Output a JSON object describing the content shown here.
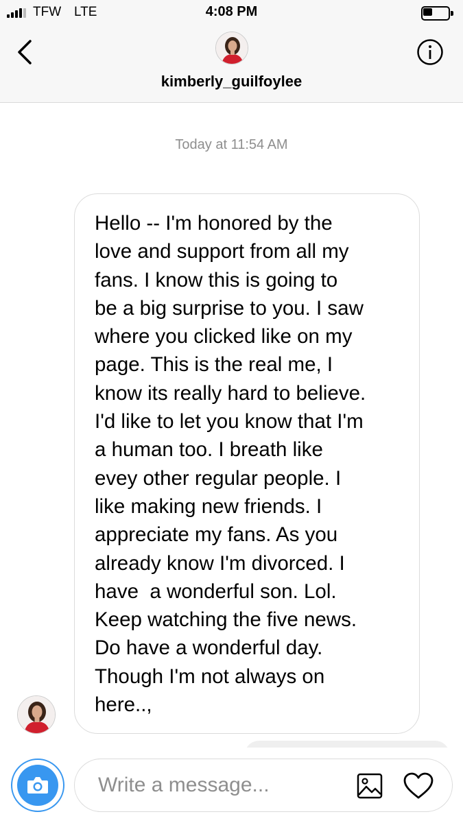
{
  "status_bar": {
    "carrier": "TFW",
    "network": "LTE",
    "time": "4:08 PM",
    "signal_bars": 4,
    "battery_level": 0.3
  },
  "header": {
    "back_icon": "chevron-left-icon",
    "username": "kimberly_guilfoylee",
    "info_icon": "info-icon"
  },
  "conversation": {
    "timestamp": "Today at 11:54 AM",
    "message": "Hello -- I'm honored by the\nlove and support from all my\nfans. I know this is going to\nbe a big surprise to you. I saw\nwhere you clicked like on my\npage. This is the real me, I\nknow its really hard to believe.\nI'd like to let you know that I'm\na human too. I breath like\nevey other regular people. I\nlike making new friends. I\nappreciate my fans. As you\nalready know I'm divorced. I\nhave  a wonderful son. Lol.\nKeep watching the five news.\nDo have a wonderful day.\nThough I'm not always on\nhere..,"
  },
  "composer": {
    "placeholder": "Write a message...",
    "camera_icon": "camera-icon",
    "gallery_icon": "image-icon",
    "like_icon": "heart-icon"
  },
  "colors": {
    "accent": "#3897f0",
    "border": "#dbdbdb",
    "muted_text": "#8e8e8e",
    "header_bg": "#f7f7f7"
  }
}
